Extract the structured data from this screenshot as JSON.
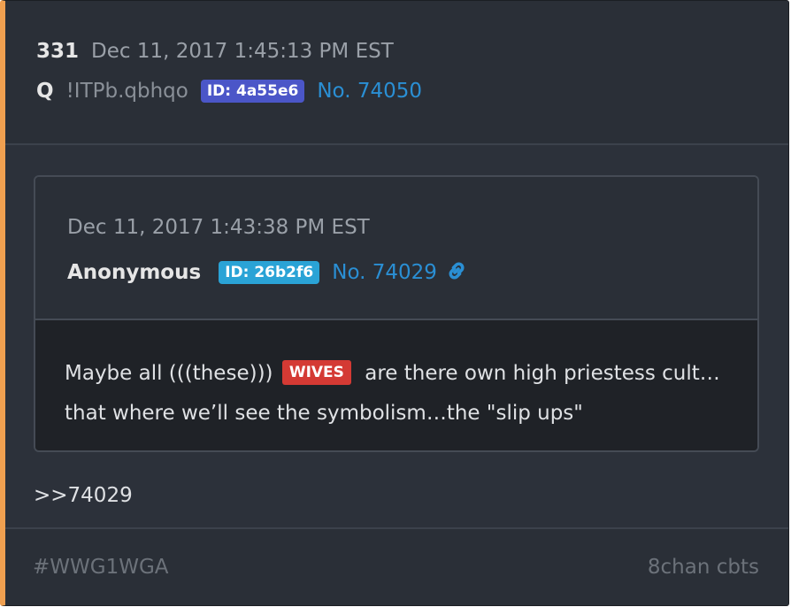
{
  "post": {
    "number": "331",
    "timestamp": "Dec 11, 2017 1:45:13 PM EST",
    "author": "Q",
    "tripcode": "!ITPb.qbhqo",
    "id_badge": "ID: 4a55e6",
    "post_no": "No. 74050",
    "accent_color": "#f0a050",
    "id_badge_color": "#4b56c8"
  },
  "quoted": {
    "timestamp": "Dec 11, 2017 1:43:38 PM EST",
    "author": "Anonymous",
    "id_badge": "ID: 26b2f6",
    "post_no": "No. 74029",
    "link_icon": "link-icon",
    "id_badge_color": "#2aa3d6",
    "text_before": "Maybe all (((these)))",
    "tag": "WIVES",
    "tag_color": "#d43a34",
    "text_after": "are there own high priestess cult…",
    "line2": "that where we’ll see the symbolism…the \"slip ups\""
  },
  "reply": {
    "text": ">>74029"
  },
  "footer": {
    "hashtag": "#WWG1WGA",
    "source": "8chan cbts"
  }
}
